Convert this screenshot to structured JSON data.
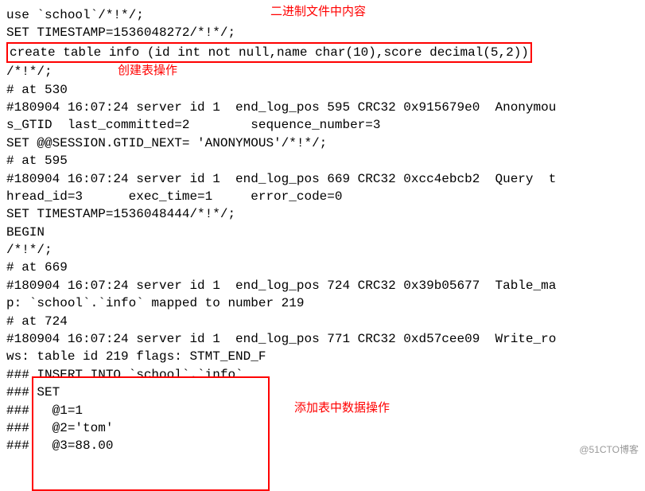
{
  "annotations": {
    "top_note": "二进制文件中内容",
    "mid_note": "创建表操作",
    "low_note": "添加表中数据操作"
  },
  "lines": {
    "l1": "use `school`/*!*/;",
    "l2": "SET TIMESTAMP=1536048272/*!*/;",
    "l3": "create table info (id int not null,name char(10),score decimal(5,2))",
    "l4": "/*!*/;",
    "l5": "# at 530",
    "l6": "#180904 16:07:24 server id 1  end_log_pos 595 CRC32 0x915679e0  Anonymou",
    "l7": "s_GTID  last_committed=2        sequence_number=3",
    "l8": "SET @@SESSION.GTID_NEXT= 'ANONYMOUS'/*!*/;",
    "l9": "# at 595",
    "l10": "#180904 16:07:24 server id 1  end_log_pos 669 CRC32 0xcc4ebcb2  Query  t",
    "l11": "hread_id=3      exec_time=1     error_code=0",
    "l12": "SET TIMESTAMP=1536048444/*!*/;",
    "l13": "BEGIN",
    "l14": "/*!*/;",
    "l15": "# at 669",
    "l16": "#180904 16:07:24 server id 1  end_log_pos 724 CRC32 0x39b05677  Table_ma",
    "l17": "p: `school`.`info` mapped to number 219",
    "l18": "# at 724",
    "l19": "#180904 16:07:24 server id 1  end_log_pos 771 CRC32 0xd57cee09  Write_ro",
    "l20": "ws: table id 219 flags: STMT_END_F",
    "l21": "### INSERT INTO `school`.`info`",
    "l22": "### SET",
    "l23": "###   @1=1",
    "l24": "###   @2='tom'",
    "l25": "###   @3=88.00"
  },
  "watermark": "@51CTO博客"
}
